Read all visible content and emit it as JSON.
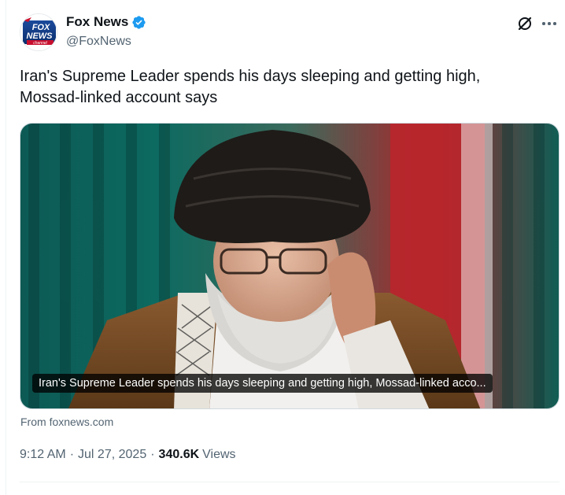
{
  "author": {
    "display_name": "Fox News",
    "handle": "@FoxNews",
    "verified": true,
    "avatar_logo_text": [
      "FOX",
      "NEWS",
      "channel"
    ],
    "brand_colors": {
      "blue": "#0a2f6e",
      "red": "#c8102e",
      "verified_blue": "#1d9bf0"
    }
  },
  "header_icons": {
    "grok": "grok-slash-icon",
    "more": "more-dots-icon"
  },
  "tweet": {
    "text": "Iran's Supreme Leader spends his days sleeping and getting high, Mossad-linked account says"
  },
  "card": {
    "caption": "Iran's Supreme Leader spends his days sleeping and getting high, Mossad-linked acco...",
    "source_prefix": "From",
    "source_domain": "foxnews.com",
    "image_subject": "photo of Iran's Supreme Leader adjusting his glasses"
  },
  "meta": {
    "time": "9:12 AM",
    "date": "Jul 27, 2025",
    "separator": "·",
    "views_count": "340.6K",
    "views_label": "Views"
  },
  "colors": {
    "text_primary": "#0f1419",
    "text_secondary": "#536471",
    "border": "#cfd9de"
  }
}
